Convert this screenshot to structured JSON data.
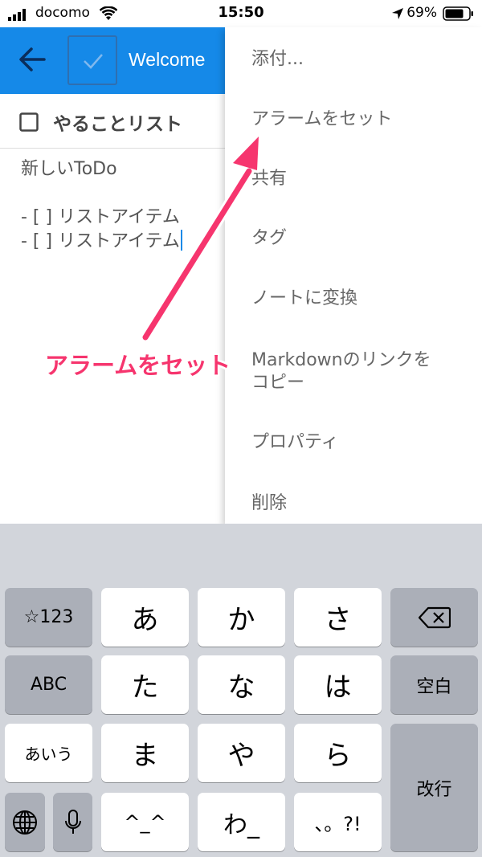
{
  "status_bar": {
    "carrier": "docomo",
    "time": "15:50",
    "battery": "69%"
  },
  "app_bar": {
    "title": "Welcome"
  },
  "list": {
    "title": "やることリスト"
  },
  "note": {
    "lines": [
      "新しいToDo",
      "- [ ] リストアイテム",
      "- [ ] リストアイテム"
    ]
  },
  "menu": {
    "items": [
      "添付...",
      "アラームをセット",
      "共有",
      "タグ",
      "ノートに変換",
      "Markdownのリンクを",
      "コピー",
      "プロパティ",
      "削除"
    ]
  },
  "annotation": {
    "text": "アラームをセット",
    "color": "#f6356e"
  },
  "keyboard": {
    "mode_numbers": "☆123",
    "mode_abc": "ABC",
    "mode_kana": "あいう",
    "row1": [
      "あ",
      "か",
      "さ"
    ],
    "row2": [
      "た",
      "な",
      "は"
    ],
    "row3": [
      "ま",
      "や",
      "ら"
    ],
    "row4": [
      "^_^",
      "わ_",
      "、。?!"
    ],
    "space": "空白",
    "return": "改行",
    "icons": [
      "delete-icon",
      "globe-icon",
      "microphone-icon"
    ]
  },
  "colors": {
    "accent": "#1589e8",
    "annotation": "#f6356e"
  }
}
